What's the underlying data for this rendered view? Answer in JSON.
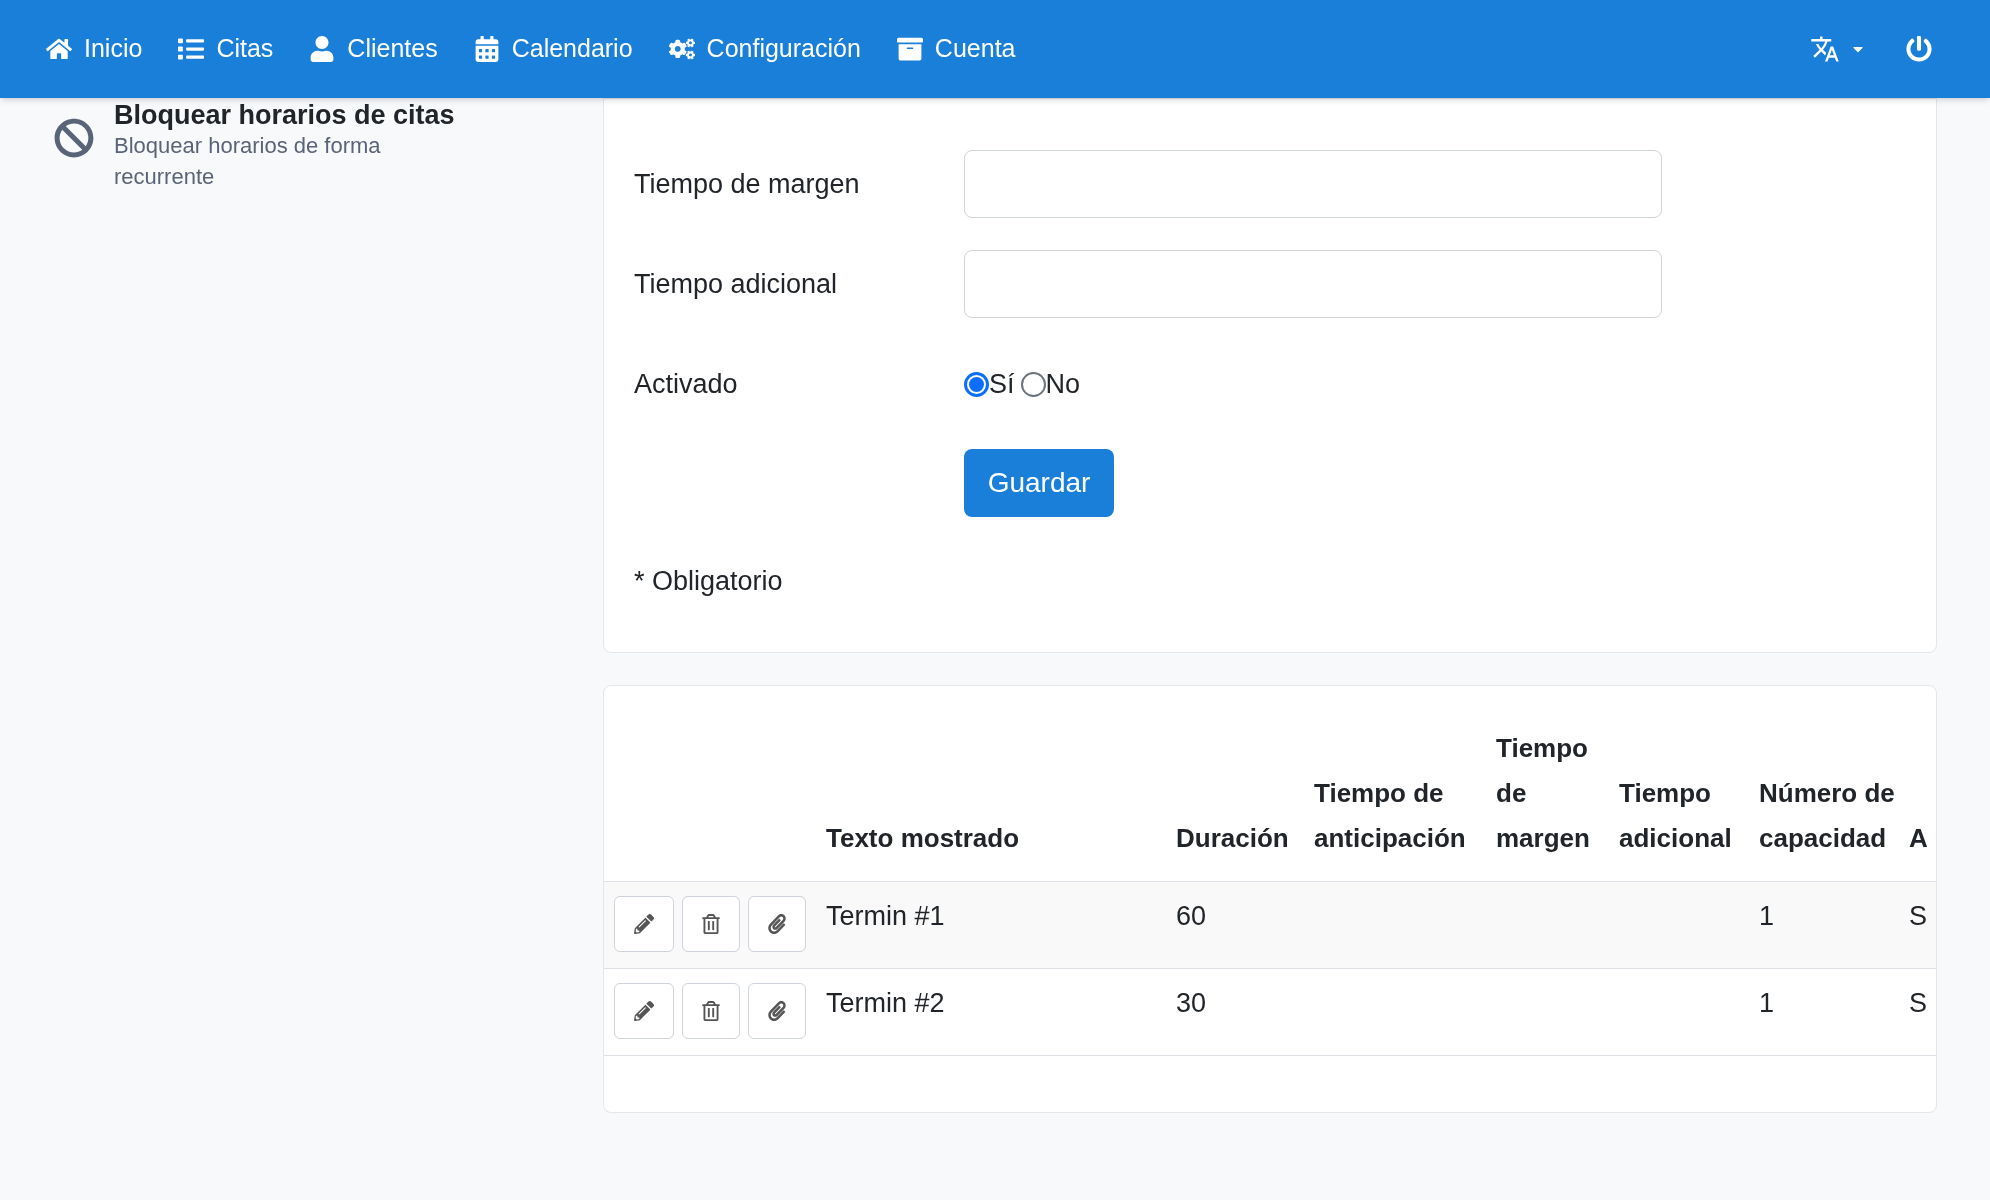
{
  "nav": {
    "items": [
      {
        "label": "Inicio"
      },
      {
        "label": "Citas"
      },
      {
        "label": "Clientes"
      },
      {
        "label": "Calendario"
      },
      {
        "label": "Configuración"
      },
      {
        "label": "Cuenta"
      }
    ]
  },
  "sidebar": {
    "title": "Bloquear horarios de citas",
    "description": "Bloquear horarios de forma recurrente"
  },
  "form": {
    "fields": [
      {
        "label": "Tiempo de margen",
        "kind": "text"
      },
      {
        "label": "Tiempo adicional",
        "kind": "text"
      },
      {
        "label": "Activado",
        "kind": "radio",
        "options": [
          {
            "label": "Sí",
            "selected": true
          },
          {
            "label": "No",
            "selected": false
          }
        ]
      }
    ],
    "save_button": "Guardar",
    "required_note": "* Obligatorio"
  },
  "table": {
    "columns": [
      "Texto mostrado",
      "Duración",
      "Tiempo de anticipación",
      "Tiempo de margen",
      "Tiempo adicional",
      "Número de capacidad",
      "A"
    ],
    "rows": [
      {
        "cells": [
          "Termin #1",
          "60",
          "",
          "",
          "",
          "1",
          "S"
        ]
      },
      {
        "cells": [
          "Termin #2",
          "30",
          "",
          "",
          "",
          "1",
          "S"
        ]
      }
    ]
  }
}
